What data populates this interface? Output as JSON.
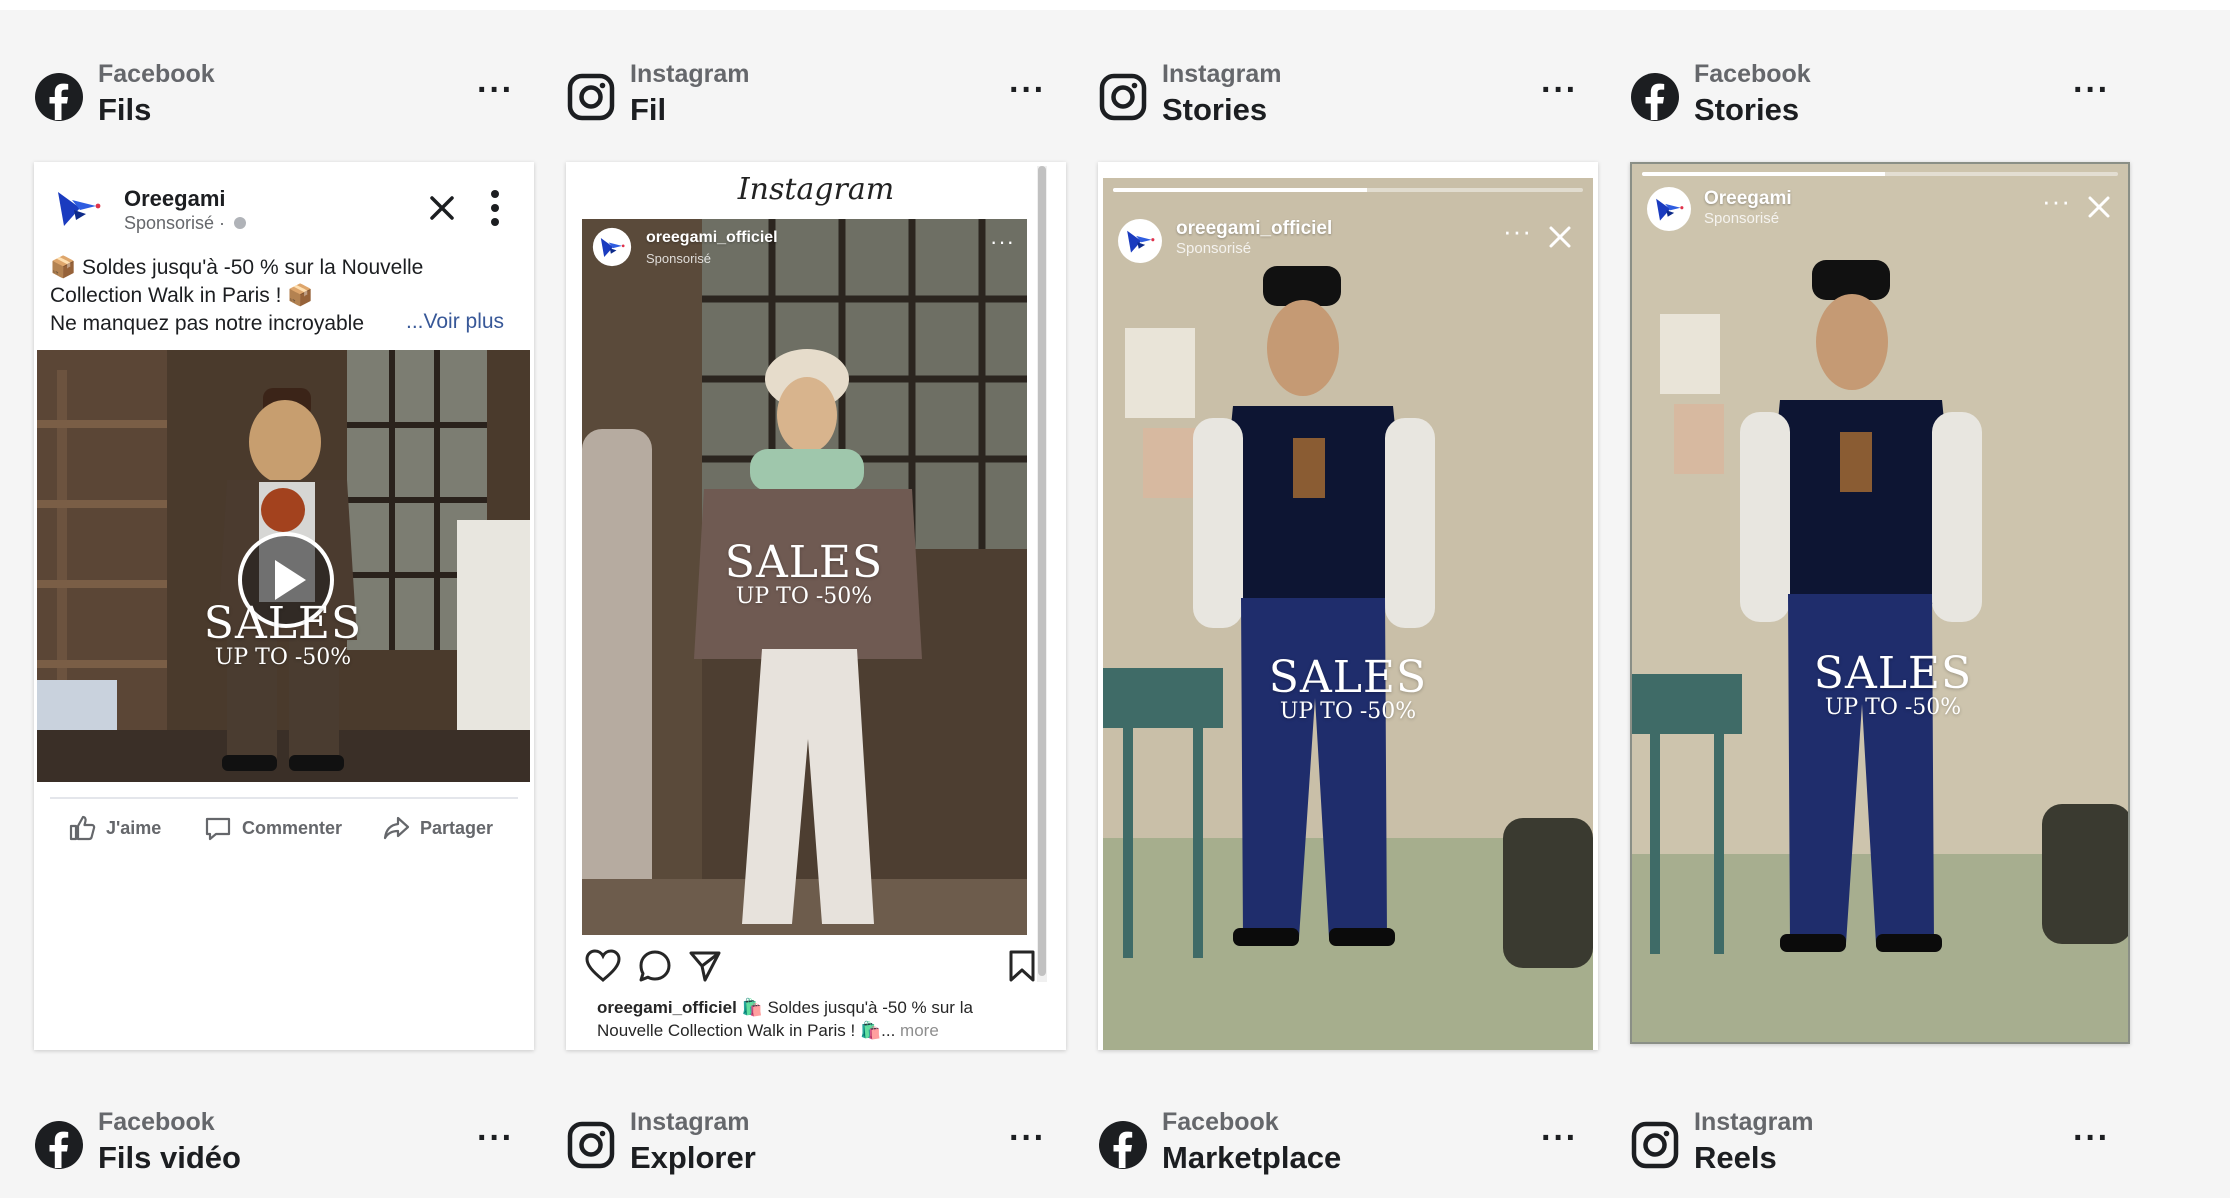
{
  "placements": {
    "top": [
      {
        "platform": "Facebook",
        "title": "Fils",
        "icon": "facebook-icon"
      },
      {
        "platform": "Instagram",
        "title": "Fil",
        "icon": "instagram-icon"
      },
      {
        "platform": "Instagram",
        "title": "Stories",
        "icon": "instagram-icon"
      },
      {
        "platform": "Facebook",
        "title": "Stories",
        "icon": "facebook-icon"
      }
    ],
    "bottom": [
      {
        "platform": "Facebook",
        "title": "Fils vidéo",
        "icon": "facebook-icon"
      },
      {
        "platform": "Instagram",
        "title": "Explorer",
        "icon": "instagram-icon"
      },
      {
        "platform": "Facebook",
        "title": "Marketplace",
        "icon": "facebook-icon"
      },
      {
        "platform": "Instagram",
        "title": "Reels",
        "icon": "instagram-icon"
      }
    ],
    "more_label": "···"
  },
  "fb_feed": {
    "page_name": "Oreegami",
    "sponsored": "Sponsorisé ·",
    "text_lines": [
      "📦 Soldes jusqu'à -50 % sur la Nouvelle",
      "Collection Walk in Paris ! 📦",
      "Ne manquez pas notre incroyable"
    ],
    "see_more": "...Voir plus",
    "overlay": {
      "title": "SALES",
      "subtitle": "UP TO -50%"
    },
    "actions": {
      "like": "J'aime",
      "comment": "Commenter",
      "share": "Partager"
    }
  },
  "ig_feed": {
    "logo": "Instagram",
    "account": "oreegami_officiel",
    "sponsored": "Sponsorisé",
    "overlay": {
      "title": "SALES",
      "subtitle": "UP TO -50%"
    },
    "caption_account": "oreegami_officiel",
    "caption_line1": "🛍️ Soldes jusqu'à -50 % sur la",
    "caption_line2": "Nouvelle Collection Walk in Paris ! 🛍️...",
    "caption_more": "more"
  },
  "ig_story": {
    "account": "oreegami_officiel",
    "sponsored": "Sponsorisé",
    "overlay": {
      "title": "SALES",
      "subtitle": "UP TO -50%"
    },
    "progress": 0.54
  },
  "fb_story": {
    "account": "Oreegami",
    "sponsored": "Sponsorisé",
    "overlay": {
      "title": "SALES",
      "subtitle": "UP TO -50%"
    },
    "progress": 0.51
  },
  "colors": {
    "facebook": "#1877f2",
    "link": "#385898",
    "background": "#f5f5f5"
  }
}
